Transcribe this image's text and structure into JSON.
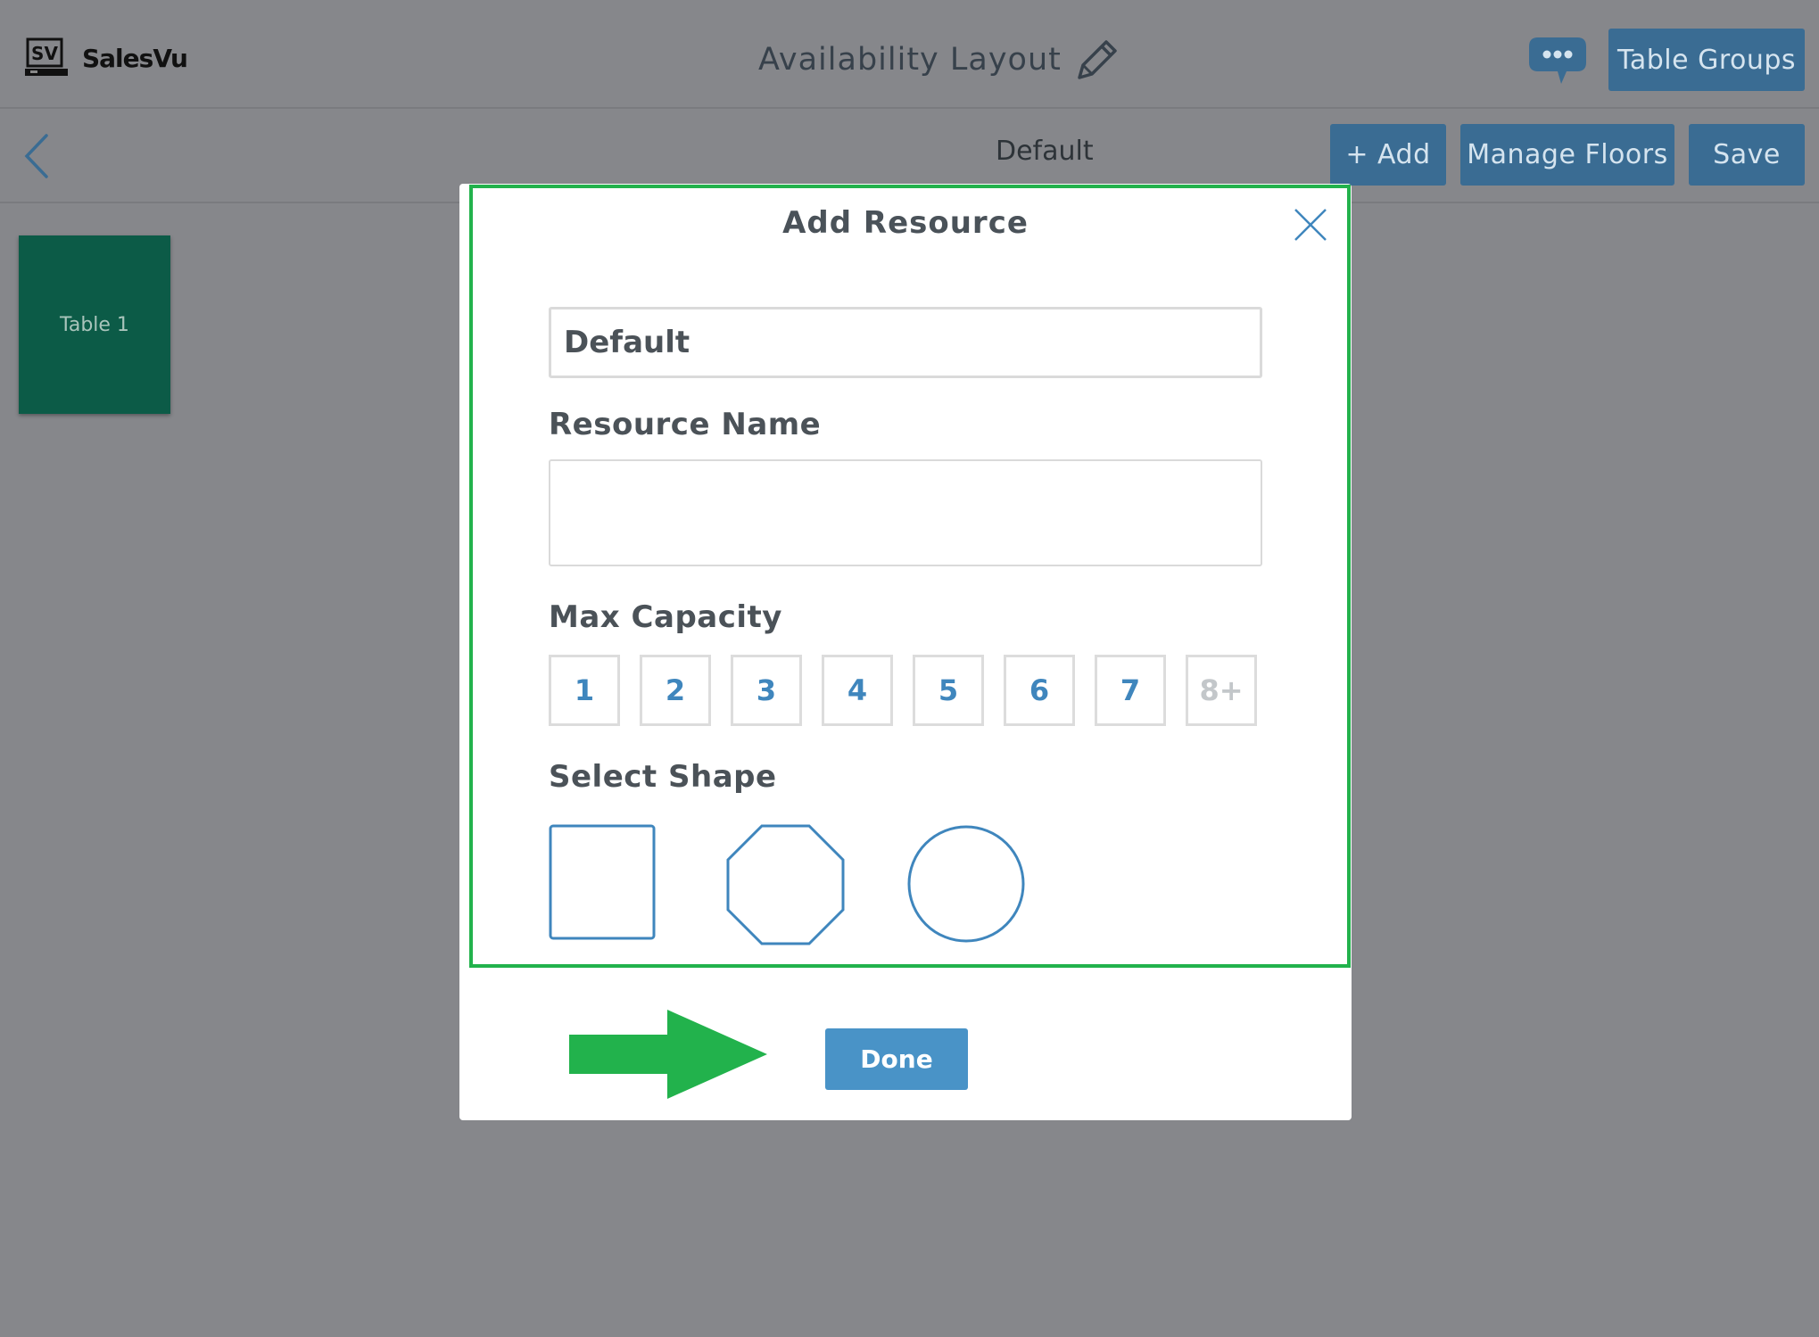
{
  "header": {
    "brand_mark": "SV",
    "brand_name": "SalesVu",
    "title": "Availability Layout",
    "table_groups_label": "Table Groups"
  },
  "toolbar": {
    "floor_name": "Default",
    "add_label": "+ Add",
    "manage_floors_label": "Manage Floors",
    "save_label": "Save"
  },
  "canvas": {
    "tables": [
      {
        "label": "Table 1",
        "color": "#0c5b47"
      }
    ]
  },
  "modal": {
    "title": "Add Resource",
    "floor_value": "Default",
    "resource_name_label": "Resource Name",
    "resource_name_value": "",
    "max_capacity_label": "Max Capacity",
    "capacity_options": [
      "1",
      "2",
      "3",
      "4",
      "5",
      "6",
      "7",
      "8+"
    ],
    "select_shape_label": "Select Shape",
    "shapes": [
      "square-icon",
      "octagon-icon",
      "circle-icon"
    ],
    "done_label": "Done"
  },
  "colors": {
    "background_overlay": "#86878b",
    "button_blue": "#3a6c93",
    "accent_blue": "#4993c7",
    "highlight_green": "#22b24c"
  }
}
